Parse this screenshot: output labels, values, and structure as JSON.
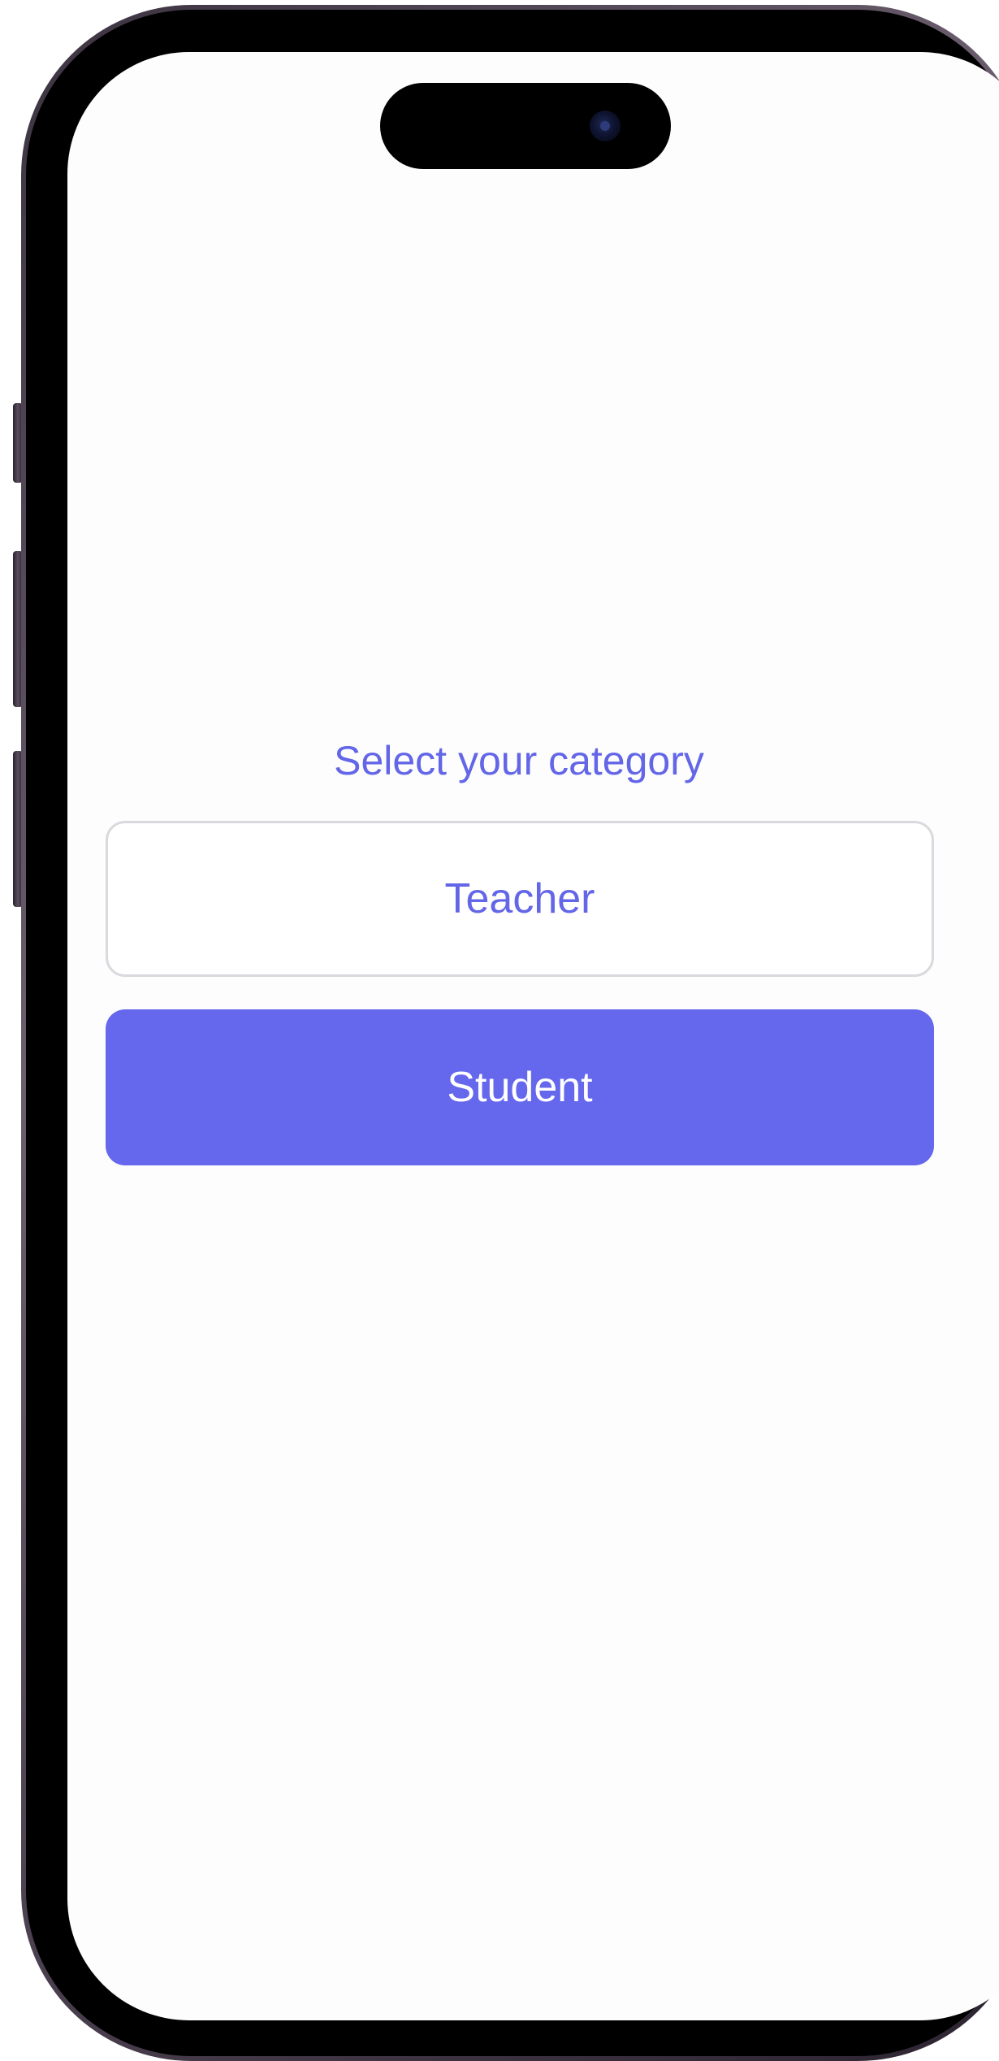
{
  "screen": {
    "title": "Select your category",
    "options": [
      {
        "label": "Teacher",
        "selected": false
      },
      {
        "label": "Student",
        "selected": true
      }
    ]
  },
  "colors": {
    "accent": "#6568ec",
    "outline": "#d9d9de",
    "background": "#fdfdfe"
  }
}
